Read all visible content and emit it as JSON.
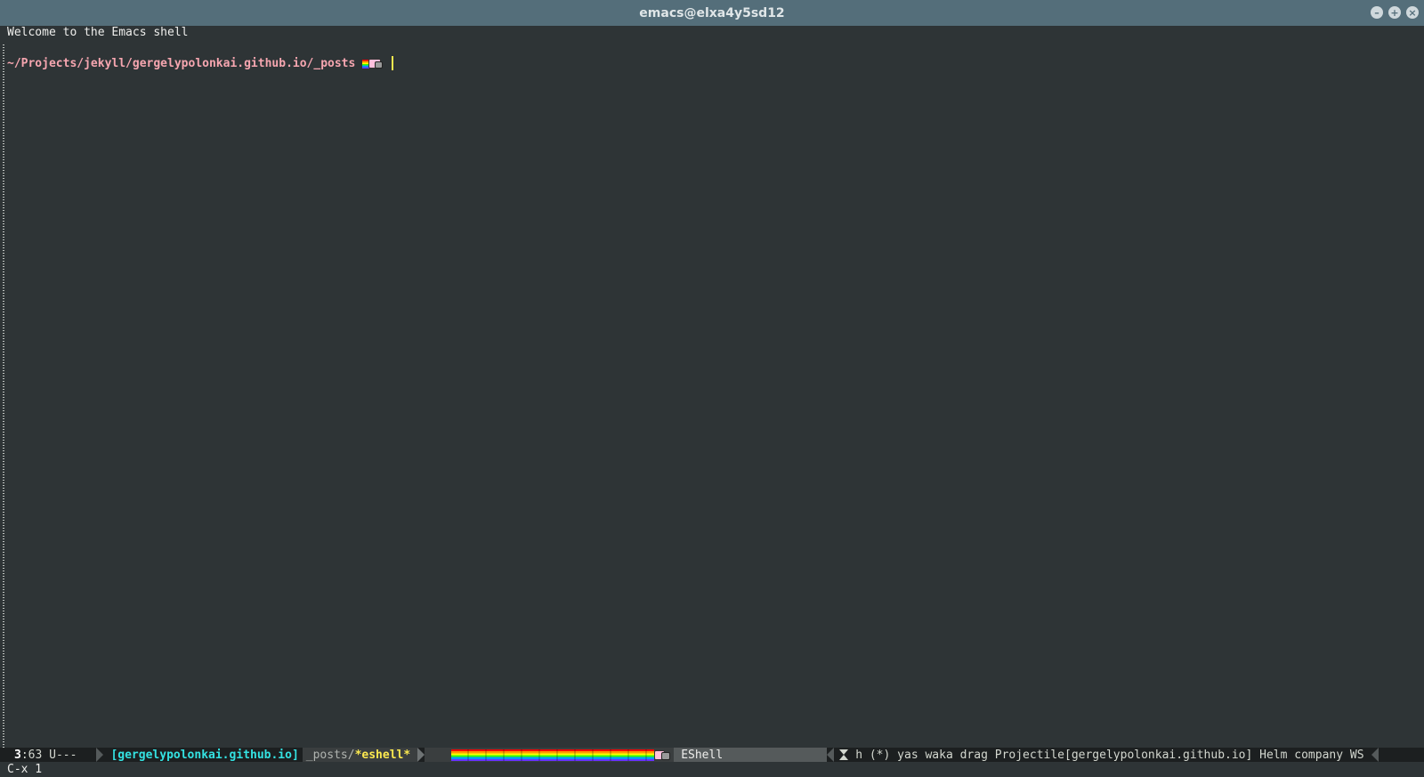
{
  "window": {
    "title": "emacs@elxa4y5sd12"
  },
  "buffer": {
    "welcome_text": "Welcome to the Emacs shell",
    "prompt_path": "~/Projects/jekyll/gergelypolonkai.github.io/_posts"
  },
  "modeline": {
    "line": "3",
    "column": ":63",
    "state": " U---",
    "project": "[gergelypolonkai.github.io]",
    "buffer_dir": "_posts/",
    "buffer_name": "*eshell*",
    "major_mode": "EShell",
    "minor_modes": "h (*) yas waka drag Projectile[gergelypolonkai.github.io] Helm company WS"
  },
  "echo_area": {
    "text": "C-x 1"
  },
  "icons": {
    "minimize": "minimize-icon",
    "maximize": "maximize-icon",
    "close": "close-icon",
    "nyan": "nyan-cat-icon",
    "hourglass": "hourglass-icon"
  },
  "colors": {
    "titlebar": "#546e7a",
    "background": "#2e3436",
    "prompt": "#f6a6b0",
    "project": "#34e2e2",
    "buffer_name": "#fce94f"
  }
}
